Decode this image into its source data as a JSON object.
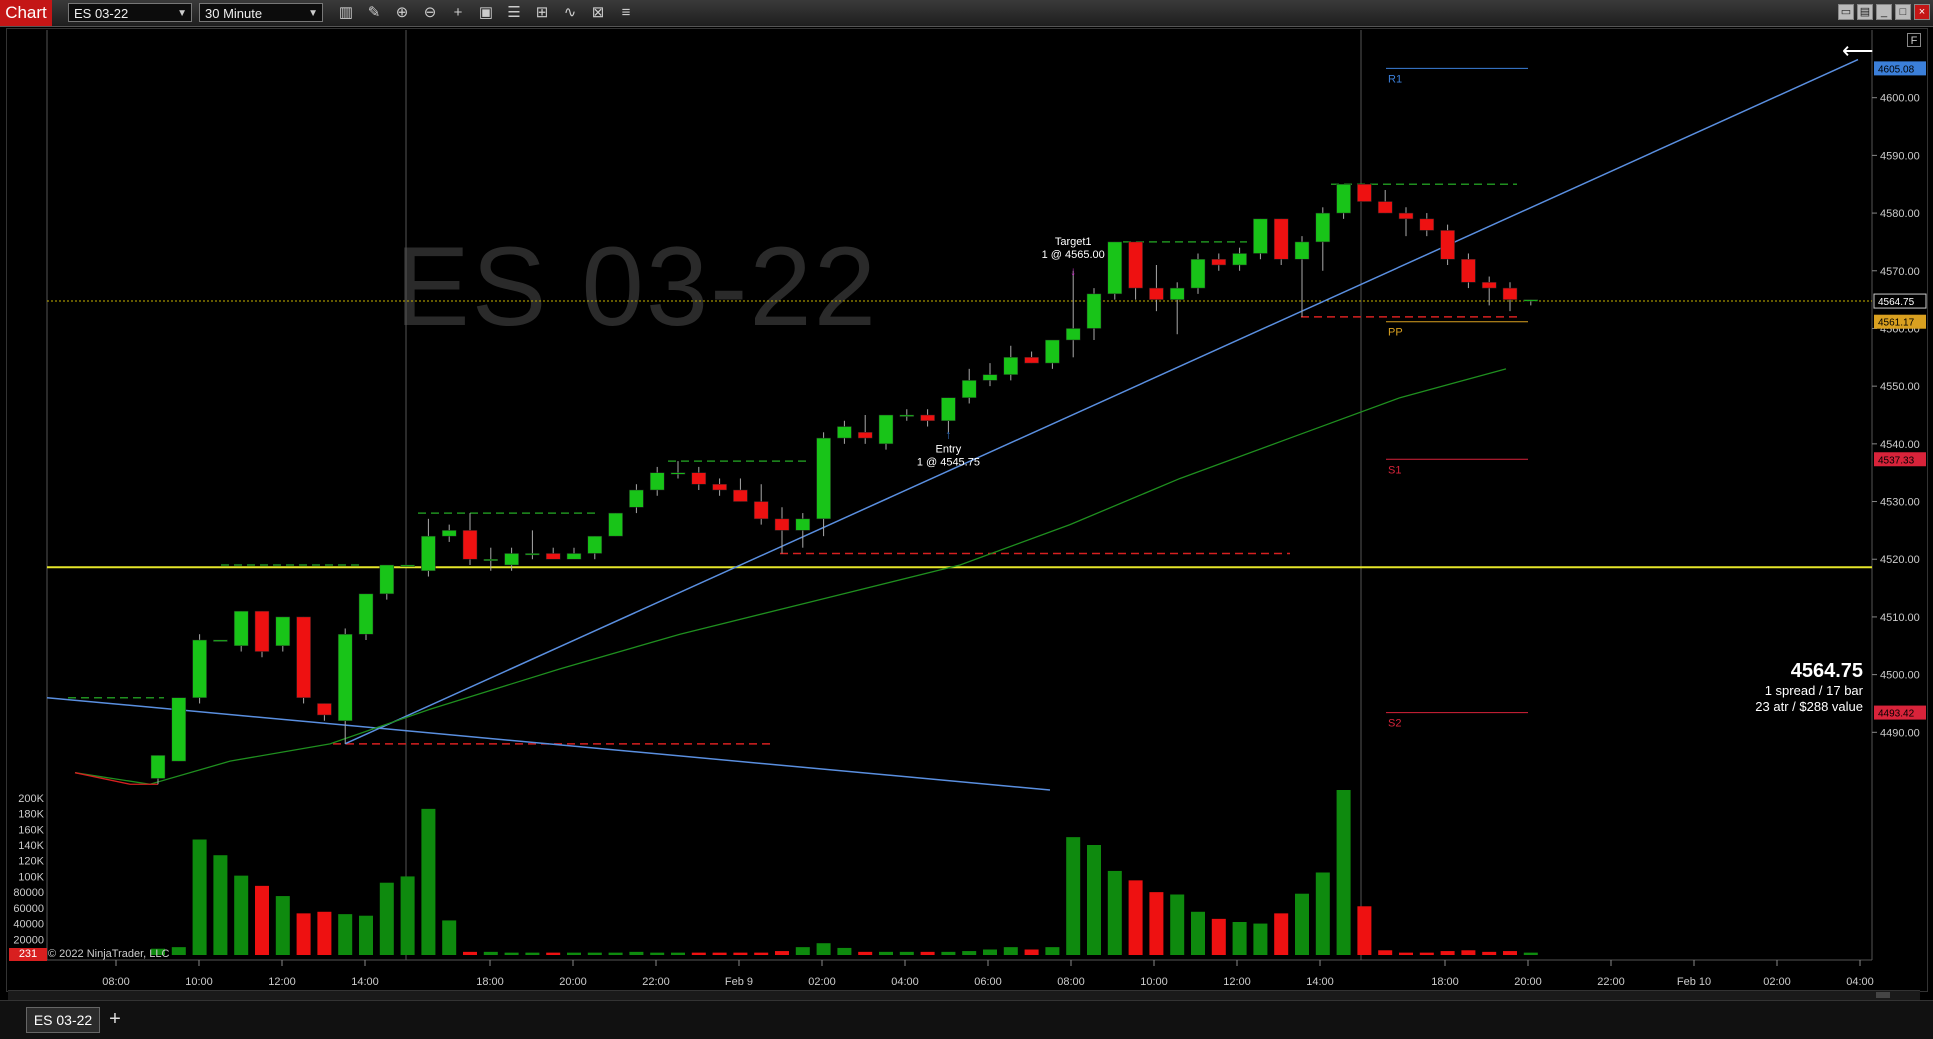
{
  "window": {
    "app_title": "Chart",
    "instrument": "ES 03-22",
    "interval": "30 Minute",
    "tab_label": "ES 03-22",
    "add_tab": "+",
    "f_button": "F"
  },
  "toolbar_icons": [
    "bar-style-icon",
    "draw-pencil-icon",
    "zoom-in-icon",
    "zoom-out-icon",
    "crosshair-icon",
    "data-box-icon",
    "properties-icon",
    "scale-icon",
    "indicators-icon",
    "strategies-icon",
    "list-icon"
  ],
  "watermark": "ES 03-22",
  "copyright": "© 2022 NinjaTrader, LLC",
  "bar_count": "231",
  "price_info": {
    "price": "4564.75",
    "line1": "1 spread / 17 bar",
    "line2": "23 atr / $288 value"
  },
  "annotations": {
    "target_label": "Target1",
    "target_detail": "1 @ 4565.00",
    "entry_label": "Entry",
    "entry_detail": "1 @ 4545.75"
  },
  "pivots": {
    "R1": {
      "label": "R1",
      "value": 4605.08,
      "marker": "4605.08",
      "color": "#3b7fd9"
    },
    "PP": {
      "label": "PP",
      "value": 4561.17,
      "marker": "4561.17",
      "color": "#d9a020"
    },
    "S1": {
      "label": "S1",
      "value": 4537.33,
      "marker": "4537.33",
      "color": "#d8233a"
    },
    "S2": {
      "label": "S2",
      "value": 4493.42,
      "marker": "4493.42",
      "color": "#d8233a"
    }
  },
  "last_price_marker": "4564.75",
  "colors": {
    "up": "#18c418",
    "down": "#ee1111",
    "volume_up": "#0e8a0e",
    "volume_down": "#ee1111",
    "trendline": "#5a8fe0",
    "yellow_line": "#e6e62a",
    "sma": "#1f8f1f",
    "swing_high": "#1f8f1f",
    "swing_low": "#d62020"
  },
  "chart_data": {
    "type": "candlestick",
    "x_tick_labels": [
      "08:00",
      "10:00",
      "12:00",
      "14:00",
      "18:00",
      "20:00",
      "22:00",
      "Feb 9",
      "02:00",
      "04:00",
      "06:00",
      "08:00",
      "10:00",
      "12:00",
      "14:00",
      "18:00",
      "20:00",
      "22:00",
      "Feb 10",
      "02:00",
      "04:00"
    ],
    "y_tick_labels": [
      "4490.00",
      "4500.00",
      "4510.00",
      "4520.00",
      "4530.00",
      "4540.00",
      "4550.00",
      "4560.00",
      "4570.00",
      "4580.00",
      "4590.00",
      "4600.00"
    ],
    "ylim": [
      4480,
      4610
    ],
    "volume_tick_labels": [
      "20000",
      "40000",
      "60000",
      "80000",
      "100K",
      "120K",
      "140K",
      "160K",
      "180K",
      "200K"
    ],
    "volume_ylim": [
      0,
      210000
    ],
    "bars": [
      {
        "o": 4482,
        "h": 4486,
        "l": 4481,
        "c": 4486,
        "v": 8000
      },
      {
        "o": 4485,
        "h": 4496,
        "l": 4485,
        "c": 4496,
        "v": 10000
      },
      {
        "o": 4496,
        "h": 4507,
        "l": 4495,
        "c": 4506,
        "v": 147000
      },
      {
        "o": 4506,
        "h": 4506,
        "l": 4506,
        "c": 4506,
        "v": 127000
      },
      {
        "o": 4505,
        "h": 4511,
        "l": 4504,
        "c": 4511,
        "v": 101000
      },
      {
        "o": 4511,
        "h": 4511,
        "l": 4503,
        "c": 4504,
        "v": 88000
      },
      {
        "o": 4505,
        "h": 4510,
        "l": 4504,
        "c": 4510,
        "v": 75000
      },
      {
        "o": 4510,
        "h": 4510,
        "l": 4495,
        "c": 4496,
        "v": 53000
      },
      {
        "o": 4495,
        "h": 4495,
        "l": 4492,
        "c": 4493,
        "v": 55000
      },
      {
        "o": 4492,
        "h": 4508,
        "l": 4488,
        "c": 4507,
        "v": 52000
      },
      {
        "o": 4507,
        "h": 4514,
        "l": 4506,
        "c": 4514,
        "v": 50000
      },
      {
        "o": 4514,
        "h": 4519,
        "l": 4513,
        "c": 4519,
        "v": 92000
      },
      {
        "o": 4519,
        "h": 4519,
        "l": 4519,
        "c": 4519,
        "v": 100000
      },
      {
        "o": 4518,
        "h": 4527,
        "l": 4517,
        "c": 4524,
        "v": 186000
      },
      {
        "o": 4524,
        "h": 4526,
        "l": 4523,
        "c": 4525,
        "v": 44000
      },
      {
        "o": 4525,
        "h": 4528,
        "l": 4519,
        "c": 4520,
        "v": 4000
      },
      {
        "o": 4520,
        "h": 4522,
        "l": 4518,
        "c": 4520,
        "v": 4000
      },
      {
        "o": 4519,
        "h": 4522,
        "l": 4518,
        "c": 4521,
        "v": 3000
      },
      {
        "o": 4521,
        "h": 4525,
        "l": 4520,
        "c": 4521,
        "v": 3000
      },
      {
        "o": 4521,
        "h": 4522,
        "l": 4520,
        "c": 4520,
        "v": 3000
      },
      {
        "o": 4520,
        "h": 4522,
        "l": 4520,
        "c": 4521,
        "v": 3000
      },
      {
        "o": 4521,
        "h": 4524,
        "l": 4520,
        "c": 4524,
        "v": 3000
      },
      {
        "o": 4524,
        "h": 4528,
        "l": 4524,
        "c": 4528,
        "v": 3000
      },
      {
        "o": 4529,
        "h": 4533,
        "l": 4528,
        "c": 4532,
        "v": 4000
      },
      {
        "o": 4532,
        "h": 4536,
        "l": 4531,
        "c": 4535,
        "v": 3000
      },
      {
        "o": 4535,
        "h": 4537,
        "l": 4534,
        "c": 4535,
        "v": 3000
      },
      {
        "o": 4535,
        "h": 4536,
        "l": 4532,
        "c": 4533,
        "v": 3000
      },
      {
        "o": 4533,
        "h": 4534,
        "l": 4531,
        "c": 4532,
        "v": 3000
      },
      {
        "o": 4532,
        "h": 4534,
        "l": 4530,
        "c": 4530,
        "v": 3000
      },
      {
        "o": 4530,
        "h": 4533,
        "l": 4526,
        "c": 4527,
        "v": 3000
      },
      {
        "o": 4527,
        "h": 4529,
        "l": 4521,
        "c": 4525,
        "v": 5000
      },
      {
        "o": 4525,
        "h": 4528,
        "l": 4522,
        "c": 4527,
        "v": 10000
      },
      {
        "o": 4527,
        "h": 4542,
        "l": 4524,
        "c": 4541,
        "v": 15000
      },
      {
        "o": 4541,
        "h": 4544,
        "l": 4540,
        "c": 4543,
        "v": 9000
      },
      {
        "o": 4542,
        "h": 4545,
        "l": 4540,
        "c": 4541,
        "v": 4000
      },
      {
        "o": 4540,
        "h": 4545,
        "l": 4539,
        "c": 4545,
        "v": 4000
      },
      {
        "o": 4545,
        "h": 4546,
        "l": 4544,
        "c": 4545,
        "v": 4000
      },
      {
        "o": 4545,
        "h": 4546,
        "l": 4543,
        "c": 4544,
        "v": 4000
      },
      {
        "o": 4544,
        "h": 4548,
        "l": 4542,
        "c": 4548,
        "v": 4000
      },
      {
        "o": 4548,
        "h": 4553,
        "l": 4547,
        "c": 4551,
        "v": 5000
      },
      {
        "o": 4551,
        "h": 4554,
        "l": 4550,
        "c": 4552,
        "v": 7000
      },
      {
        "o": 4552,
        "h": 4557,
        "l": 4551,
        "c": 4555,
        "v": 10000
      },
      {
        "o": 4555,
        "h": 4556,
        "l": 4554,
        "c": 4554,
        "v": 7000
      },
      {
        "o": 4554,
        "h": 4558,
        "l": 4553,
        "c": 4558,
        "v": 10000
      },
      {
        "o": 4558,
        "h": 4570,
        "l": 4555,
        "c": 4560,
        "v": 150000
      },
      {
        "o": 4560,
        "h": 4567,
        "l": 4558,
        "c": 4566,
        "v": 140000
      },
      {
        "o": 4566,
        "h": 4575,
        "l": 4565,
        "c": 4575,
        "v": 107000
      },
      {
        "o": 4575,
        "h": 4575,
        "l": 4565,
        "c": 4567,
        "v": 95000
      },
      {
        "o": 4567,
        "h": 4571,
        "l": 4563,
        "c": 4565,
        "v": 80000
      },
      {
        "o": 4565,
        "h": 4568,
        "l": 4559,
        "c": 4567,
        "v": 77000
      },
      {
        "o": 4567,
        "h": 4573,
        "l": 4566,
        "c": 4572,
        "v": 55000
      },
      {
        "o": 4572,
        "h": 4573,
        "l": 4570,
        "c": 4571,
        "v": 46000
      },
      {
        "o": 4571,
        "h": 4574,
        "l": 4570,
        "c": 4573,
        "v": 42000
      },
      {
        "o": 4573,
        "h": 4579,
        "l": 4572,
        "c": 4579,
        "v": 40000
      },
      {
        "o": 4579,
        "h": 4579,
        "l": 4571,
        "c": 4572,
        "v": 53000
      },
      {
        "o": 4572,
        "h": 4576,
        "l": 4562,
        "c": 4575,
        "v": 78000
      },
      {
        "o": 4575,
        "h": 4581,
        "l": 4570,
        "c": 4580,
        "v": 105000
      },
      {
        "o": 4580,
        "h": 4585,
        "l": 4579,
        "c": 4585,
        "v": 210000
      },
      {
        "o": 4585,
        "h": 4585,
        "l": 4582,
        "c": 4582,
        "v": 62000
      },
      {
        "o": 4582,
        "h": 4584,
        "l": 4580,
        "c": 4580,
        "v": 6000
      },
      {
        "o": 4580,
        "h": 4581,
        "l": 4576,
        "c": 4579,
        "v": 3000
      },
      {
        "o": 4579,
        "h": 4580,
        "l": 4576,
        "c": 4577,
        "v": 3000
      },
      {
        "o": 4577,
        "h": 4578,
        "l": 4571,
        "c": 4572,
        "v": 5000
      },
      {
        "o": 4572,
        "h": 4573,
        "l": 4567,
        "c": 4568,
        "v": 6000
      },
      {
        "o": 4568,
        "h": 4569,
        "l": 4564,
        "c": 4567,
        "v": 4000
      },
      {
        "o": 4567,
        "h": 4568,
        "l": 4563,
        "c": 4565,
        "v": 5000
      },
      {
        "o": 4565,
        "h": 4565,
        "l": 4564,
        "c": 4565,
        "v": 3000
      }
    ]
  }
}
